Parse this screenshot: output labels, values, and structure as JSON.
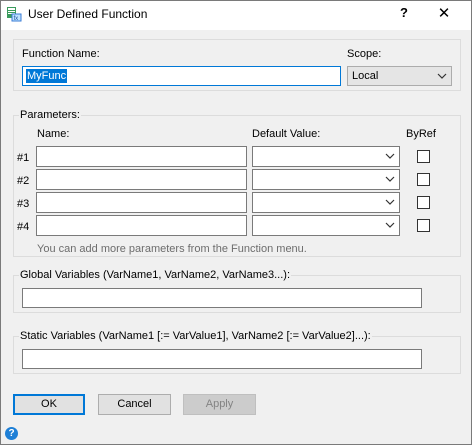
{
  "window": {
    "title": "User Defined Function",
    "help_glyph": "?",
    "close_glyph": "✕"
  },
  "function": {
    "name_label": "Function Name:",
    "name_value": "MyFunc",
    "scope_label": "Scope:",
    "scope_value": "Local"
  },
  "parameters": {
    "group_label": "Parameters:",
    "col_name": "Name:",
    "col_default": "Default Value:",
    "col_byref": "ByRef",
    "rows": [
      {
        "label": "#1",
        "name": "",
        "default": "",
        "byref": false
      },
      {
        "label": "#2",
        "name": "",
        "default": "",
        "byref": false
      },
      {
        "label": "#3",
        "name": "",
        "default": "",
        "byref": false
      },
      {
        "label": "#4",
        "name": "",
        "default": "",
        "byref": false
      }
    ],
    "hint": "You can add more parameters from the Function menu."
  },
  "global_vars": {
    "label": "Global Variables (VarName1, VarName2, VarName3...):",
    "value": ""
  },
  "static_vars": {
    "label": "Static Variables (VarName1 [:= VarValue1], VarName2 [:= VarValue2]...):",
    "value": ""
  },
  "buttons": {
    "ok": "OK",
    "cancel": "Cancel",
    "apply": "Apply"
  },
  "status": {
    "help_glyph": "?"
  },
  "colors": {
    "accent": "#0078d7",
    "dialog_bg": "#f0f0f0"
  }
}
